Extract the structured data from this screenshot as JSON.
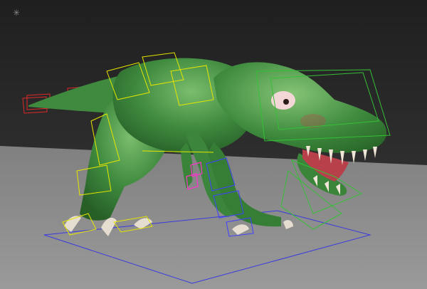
{
  "viewport": {
    "kind": "3d-perspective-viewport",
    "subject": "dinosaur-character-rig",
    "colors": {
      "background_top": "#1f1f1f",
      "background_bottom": "#3a3a3a",
      "ground": "#8e8e8e",
      "skin": "#3f8a3f",
      "skin_dark": "#2a6a2a",
      "skin_highlight": "#77b86a",
      "claw": "#e6ddd1",
      "mouth": "#b8404a",
      "eye": "#f3d6d6",
      "rig_tail": "#e02828",
      "rig_body": "#e6e600",
      "rig_head": "#35c035",
      "rig_ground": "#3a3adf",
      "rig_leg": "#4040ff",
      "rig_accent": "#ff33cc"
    },
    "icons": [
      "bone-rig-icon"
    ]
  }
}
